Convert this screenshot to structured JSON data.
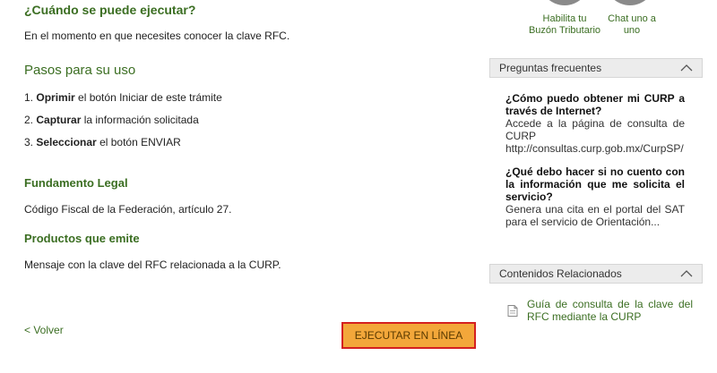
{
  "main": {
    "when_title": "¿Cuándo se puede ejecutar?",
    "when_text": "En el momento en que necesites conocer la clave RFC.",
    "steps_title": "Pasos para su uso",
    "steps": [
      {
        "num": "1.",
        "bold": "Oprimir",
        "rest": " el botón Iniciar de este trámite"
      },
      {
        "num": "2.",
        "bold": "Capturar",
        "rest": " la información solicitada"
      },
      {
        "num": "3.",
        "bold": "Seleccionar",
        "rest": " el botón ENVIAR"
      }
    ],
    "legal_title": "Fundamento Legal",
    "legal_text": "Código Fiscal de la Federación, artículo 27.",
    "products_title": "Productos que emite",
    "products_text": "Mensaje con la clave del RFC relacionada a la CURP.",
    "back_label": "< Volver",
    "execute_label": "EJECUTAR EN LÍNEA"
  },
  "sidebar": {
    "icons": [
      {
        "icon": "mailbox-icon",
        "line1": "Habilita tu",
        "line2": "Buzón Tributario"
      },
      {
        "icon": "chat-icon",
        "line1": "Chat uno a",
        "line2": "uno"
      }
    ],
    "faq_title": "Preguntas frecuentes",
    "faqs": [
      {
        "q": "¿Cómo puedo obtener mi CURP a través de Internet?",
        "a": "Accede a la página de consulta de CURP http://consultas.curp.gob.mx/CurpSP/"
      },
      {
        "q": "¿Qué debo hacer si no cuento con la información que me solicita el servicio?",
        "a": "Genera una cita en el portal del SAT para el servicio de Orientación..."
      }
    ],
    "related_title": "Contenidos Relacionados",
    "related": [
      {
        "label": "Guía de consulta de la clave del RFC mediante la CURP"
      }
    ]
  },
  "colors": {
    "accent": "#3b6e22",
    "button": "#f3a73a",
    "button_border": "#d42020"
  }
}
